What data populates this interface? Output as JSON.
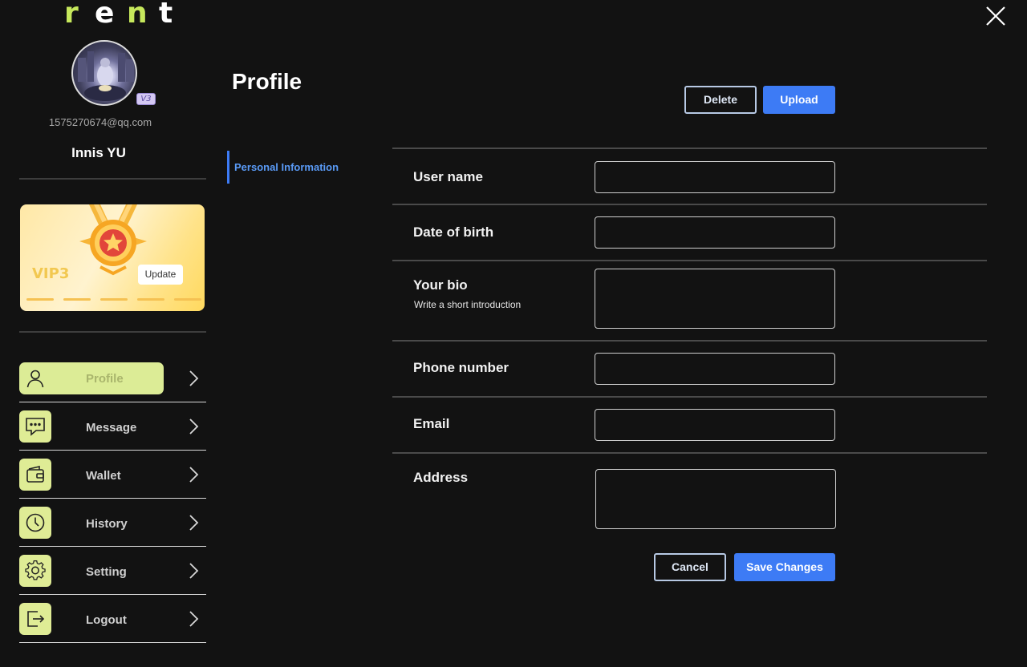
{
  "app": {
    "logo_letters": [
      "r",
      "e",
      "n",
      "t"
    ],
    "close_icon": "close-icon"
  },
  "user": {
    "email": "1575270674@qq.com",
    "name": "Innis YU",
    "badge": "V3"
  },
  "vip_card": {
    "level": "VIP3",
    "update_label": "Update"
  },
  "nav": {
    "items": [
      {
        "label": "Profile",
        "icon": "user-icon",
        "active": true
      },
      {
        "label": "Message",
        "icon": "message-icon",
        "active": false
      },
      {
        "label": "Wallet",
        "icon": "wallet-icon",
        "active": false
      },
      {
        "label": "History",
        "icon": "clock-icon",
        "active": false
      },
      {
        "label": "Setting",
        "icon": "gear-icon",
        "active": false
      },
      {
        "label": "Logout",
        "icon": "logout-icon",
        "active": false
      }
    ]
  },
  "main": {
    "title": "Profile",
    "delete_label": "Delete",
    "upload_label": "Upload",
    "tab_label": "Personal Information",
    "fields": {
      "username": {
        "label": "User name",
        "value": ""
      },
      "dob": {
        "label": "Date of birth",
        "value": ""
      },
      "bio": {
        "label": "Your bio",
        "sublabel": "Write a short introduction",
        "value": ""
      },
      "phone": {
        "label": "Phone number",
        "value": ""
      },
      "email": {
        "label": "Email",
        "value": ""
      },
      "address": {
        "label": "Address",
        "value": ""
      }
    },
    "cancel_label": "Cancel",
    "save_label": "Save Changes"
  },
  "colors": {
    "background": "#121212",
    "accent_green": "#c6e85c",
    "nav_icon_bg": "#dfec95",
    "primary_blue": "#3d7bf5",
    "tab_blue": "#5a9bf7"
  }
}
